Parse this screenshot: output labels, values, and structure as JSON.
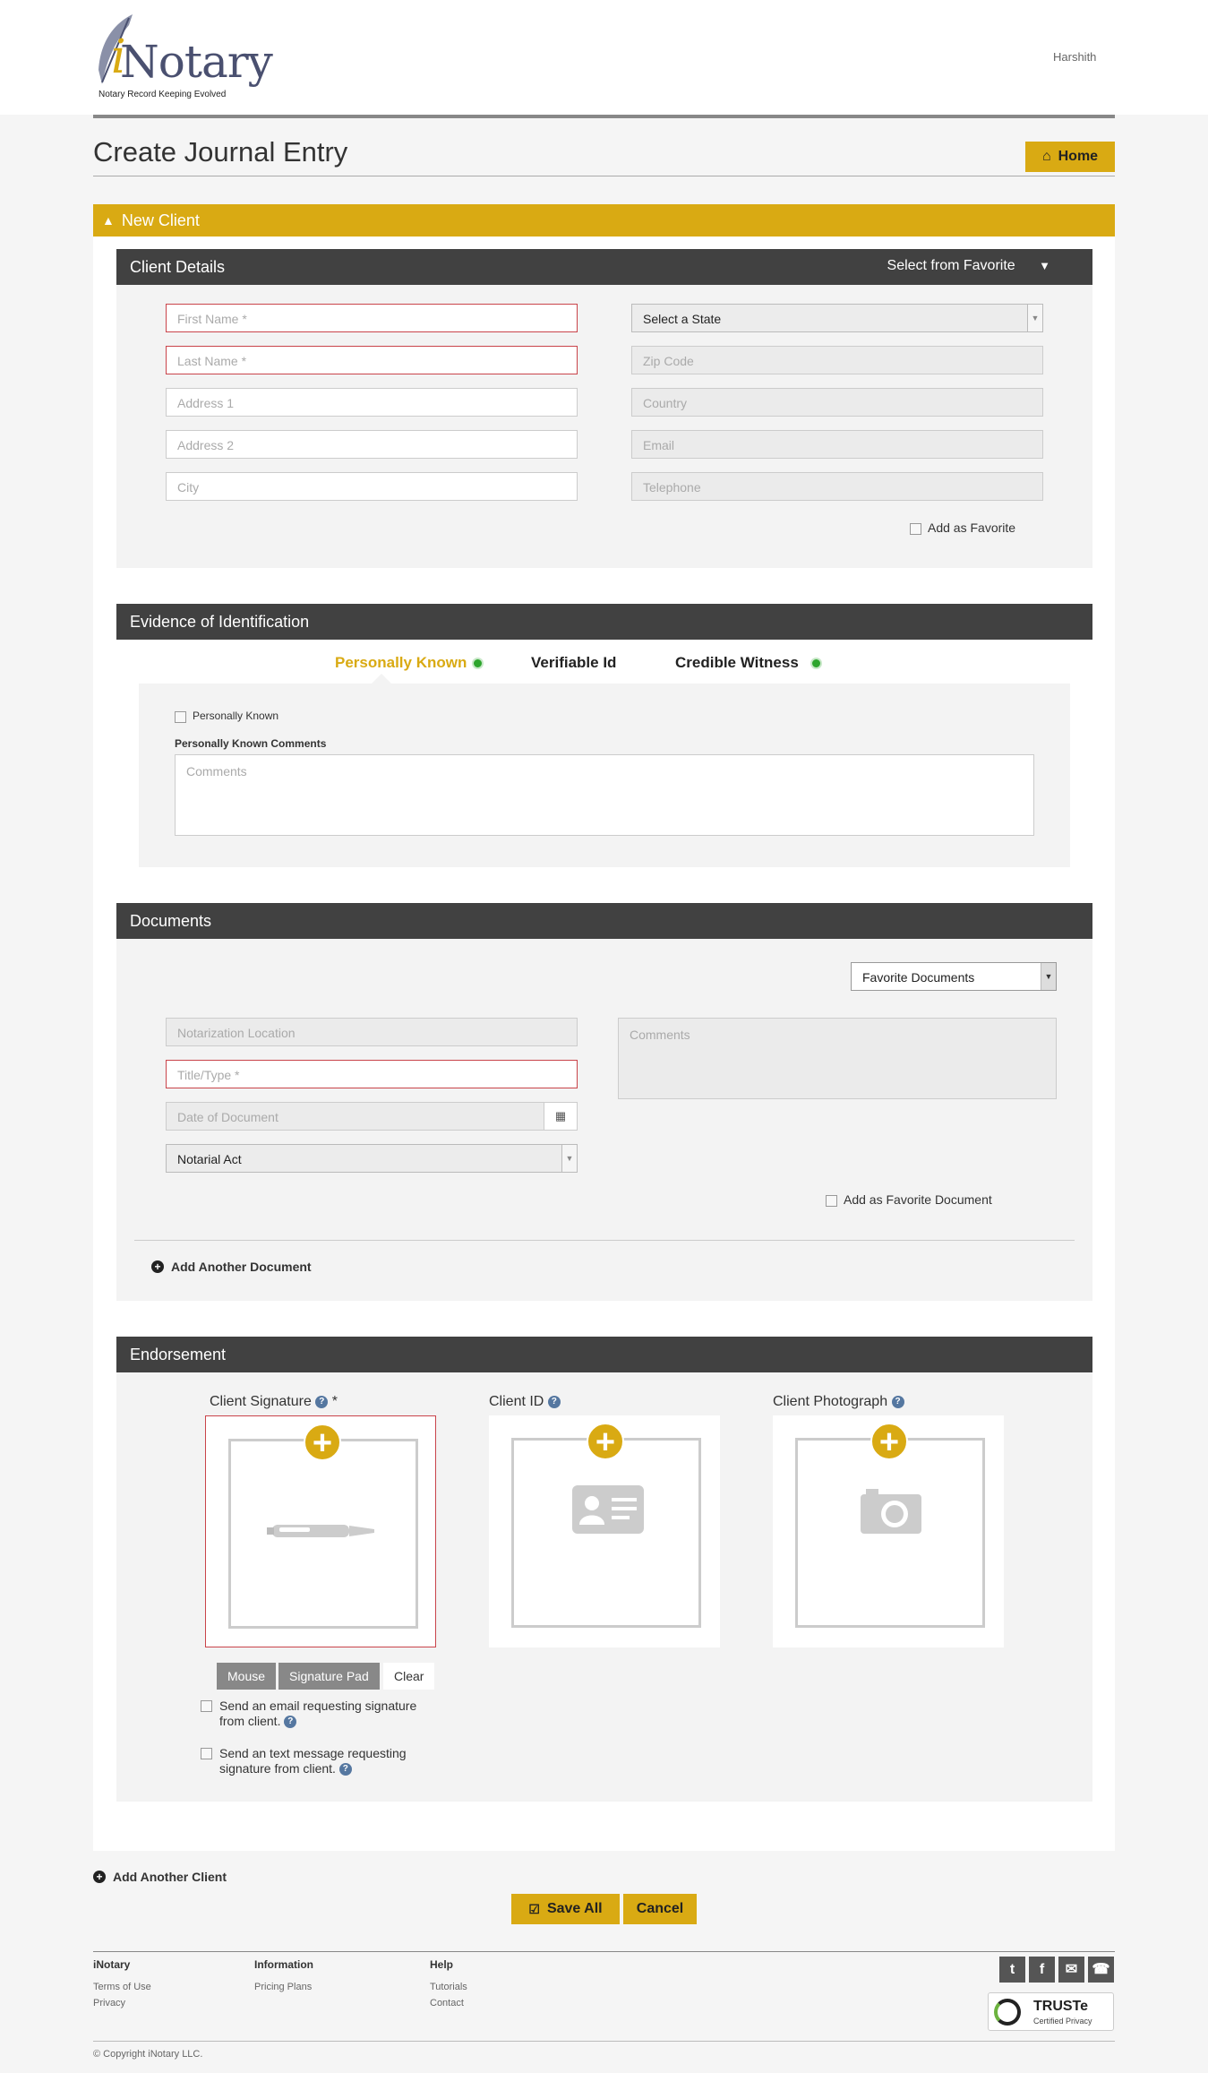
{
  "header": {
    "logo_text": "Notary",
    "logo_i": "i",
    "tagline": "Notary Record Keeping Evolved",
    "user": "Harshith"
  },
  "page": {
    "title": "Create Journal Entry",
    "home_label": "Home"
  },
  "new_client": {
    "label": "New Client"
  },
  "client_details": {
    "title": "Client Details",
    "favorite_select": "Select from Favorite",
    "first_name": "First Name *",
    "last_name": "Last Name *",
    "address1": "Address 1",
    "address2": "Address 2",
    "city": "City",
    "state": "Select a State",
    "zip": "Zip Code",
    "country": "Country",
    "email": "Email",
    "telephone": "Telephone",
    "add_favorite": "Add as Favorite"
  },
  "evidence": {
    "title": "Evidence of Identification",
    "tabs": [
      "Personally Known",
      "Verifiable Id",
      "Credible Witness"
    ],
    "personally_known_checkbox": "Personally Known",
    "comments_label": "Personally Known Comments",
    "comments_placeholder": "Comments"
  },
  "documents": {
    "title": "Documents",
    "favorite_documents": "Favorite Documents",
    "location": "Notarization Location",
    "title_type": "Title/Type *",
    "date": "Date of Document",
    "notarial_act": "Notarial Act",
    "comments": "Comments",
    "add_favorite": "Add as Favorite Document",
    "add_another": "Add Another Document"
  },
  "endorsement": {
    "title": "Endorsement",
    "signature": "Client Signature",
    "required_mark": "*",
    "client_id": "Client ID",
    "photo": "Client Photograph",
    "mouse": "Mouse",
    "signature_pad": "Signature Pad",
    "clear": "Clear",
    "email_request": "Send an email requesting signature",
    "email_request2": "from client.",
    "text_request": "Send an text message requesting",
    "text_request2": "signature from client."
  },
  "actions": {
    "add_client": "Add Another Client",
    "save": "Save All",
    "cancel": "Cancel"
  },
  "footer": {
    "col1": {
      "heading": "iNotary",
      "links": [
        "Terms of Use",
        "Privacy"
      ]
    },
    "col2": {
      "heading": "Information",
      "links": [
        "Pricing Plans"
      ]
    },
    "col3": {
      "heading": "Help",
      "links": [
        "Tutorials",
        "Contact"
      ]
    },
    "truste": "TRUSTe",
    "truste_sub": "Certified Privacy",
    "copyright": "© Copyright iNotary LLC."
  },
  "colors": {
    "accent": "#d9aa13",
    "dark_bar": "#414141",
    "error": "#c9444a",
    "status_green": "#2da52d"
  }
}
